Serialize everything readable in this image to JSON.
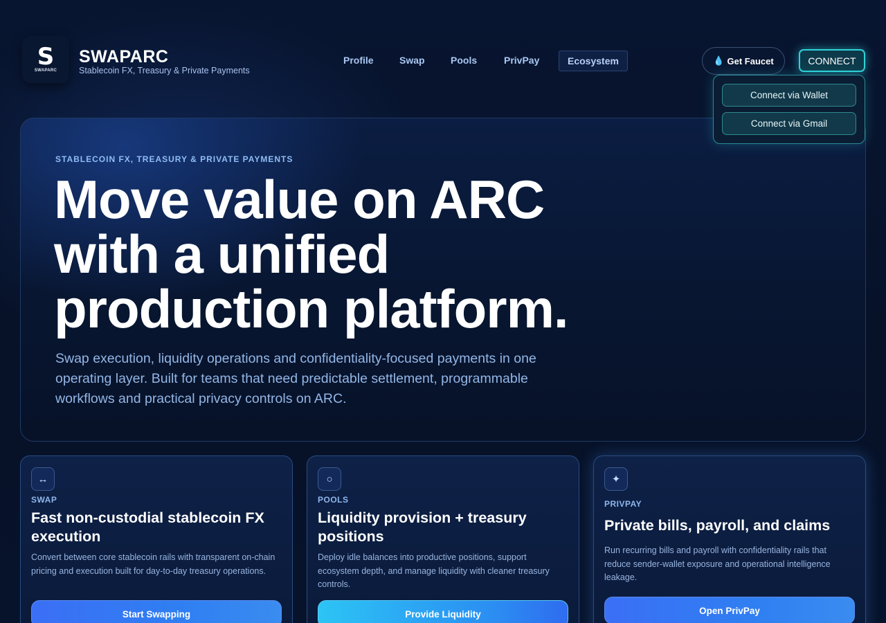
{
  "brand": {
    "logo_letter": "S",
    "logo_word": "SWAPARC",
    "name": "SWAPARC",
    "tagline": "Stablecoin FX, Treasury & Private Payments"
  },
  "nav": {
    "items": [
      {
        "label": "Profile"
      },
      {
        "label": "Swap"
      },
      {
        "label": "Pools"
      },
      {
        "label": "PrivPay"
      },
      {
        "label": "Ecosystem",
        "active": true
      }
    ]
  },
  "header": {
    "faucet_label": "Get Faucet",
    "faucet_icon": "water-drop-icon",
    "connect_label": "CONNECT"
  },
  "connect_menu": {
    "options": [
      {
        "label": "Connect via Wallet"
      },
      {
        "label": "Connect via Gmail"
      }
    ]
  },
  "hero": {
    "eyebrow": "STABLECOIN FX, TREASURY & PRIVATE PAYMENTS",
    "title": "Move value on ARC with a unified production platform.",
    "subtitle": "Swap execution, liquidity operations and confidentiality-focused payments in one operating layer. Built for teams that need predictable settlement, programmable workflows and practical privacy controls on ARC."
  },
  "cards": [
    {
      "icon": "swap-arrows-icon",
      "label": "SWAP",
      "title": "Fast non-custodial stablecoin FX execution",
      "description": "Convert between core stablecoin rails with transparent on-chain pricing and execution built for day-to-day treasury operations.",
      "button": "Start Swapping"
    },
    {
      "icon": "circle-icon",
      "label": "POOLS",
      "title": "Liquidity provision + treasury positions",
      "description": "Deploy idle balances into productive positions, support ecosystem depth, and manage liquidity with cleaner treasury controls.",
      "button": "Provide Liquidity"
    },
    {
      "icon": "sparkle-icon",
      "label": "PRIVPAY",
      "title": "Private bills, payroll, and claims",
      "description": "Run recurring bills and payroll with confidentiality rails that reduce sender-wallet exposure and operational intelligence leakage.",
      "button": "Open PrivPay"
    }
  ],
  "colors": {
    "background": "#07122a",
    "accent_cyan": "#2fd3d9",
    "accent_blue": "#3b6ff5",
    "eyebrow": "#8fbdf5"
  }
}
